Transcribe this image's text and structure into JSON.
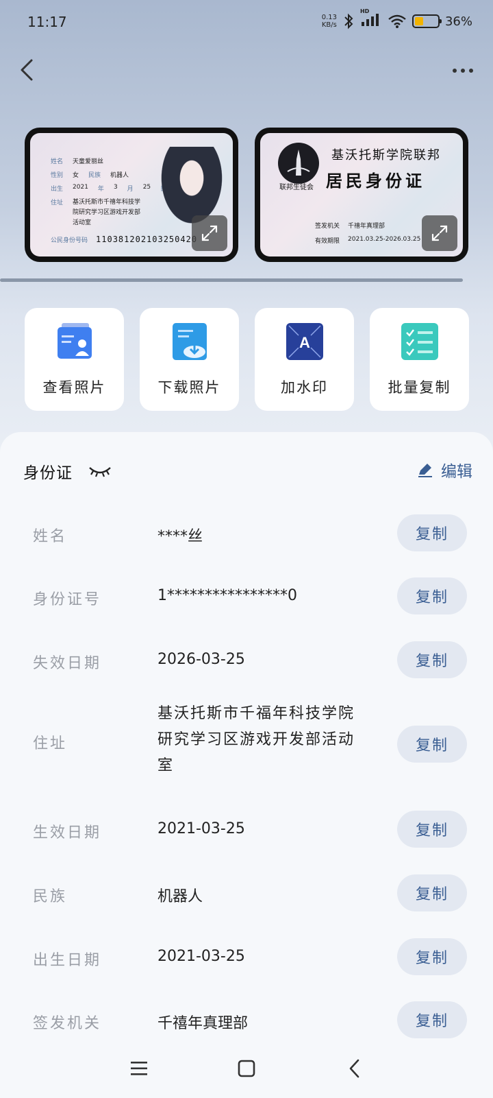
{
  "status": {
    "time": "11:17",
    "net_speed_value": "0.13",
    "net_speed_unit": "KB/s",
    "hd_label": "HD",
    "battery_level": 0.36,
    "battery_pct": "36%",
    "battery_fill_color": "#f2b300"
  },
  "cards": {
    "front": {
      "name_label": "姓名",
      "name": "天童爱丽丝",
      "sex_label": "性别",
      "sex": "女",
      "ethnicity_label": "民族",
      "ethnicity": "机器人",
      "birth_label": "出生",
      "birth_year": "2021",
      "birth_year_unit": "年",
      "birth_month": "3",
      "birth_month_unit": "月",
      "birth_day": "25",
      "birth_day_unit": "日",
      "address_label": "住址",
      "address_line1": "基沃托斯市千禧年科技学",
      "address_line2": "院研究学习区游戏开发部",
      "address_line3": "活动室",
      "id_label": "公民身份号码",
      "id_number": "110381202103250420"
    },
    "back": {
      "title1": "基沃托斯学院联邦",
      "title2": "居民身份证",
      "union_name": "联邦生徒会",
      "authority_label": "签发机关",
      "authority": "千禧年真理部",
      "validity_label": "有效期限",
      "validity": "2021.03.25-2026.03.25"
    }
  },
  "actions": [
    {
      "label": "查看照片",
      "icon": "view-photo-icon"
    },
    {
      "label": "下载照片",
      "icon": "download-photo-icon"
    },
    {
      "label": "加水印",
      "icon": "watermark-icon"
    },
    {
      "label": "批量复制",
      "icon": "batch-copy-icon"
    }
  ],
  "sheet": {
    "title": "身份证",
    "edit_label": "编辑",
    "copy_label": "复制",
    "rows": [
      {
        "key": "姓名",
        "value": "****丝"
      },
      {
        "key": "身份证号",
        "value": "1****************0"
      },
      {
        "key": "失效日期",
        "value": "2026-03-25"
      },
      {
        "key": "住址",
        "value_lines": [
          "基沃托斯市千福年科技学院",
          "研究学习区游戏开发部活动",
          "室"
        ]
      },
      {
        "key": "生效日期",
        "value": "2021-03-25"
      },
      {
        "key": "民族",
        "value": "机器人"
      },
      {
        "key": "出生日期",
        "value": "2021-03-25"
      },
      {
        "key": "签发机关",
        "value": "千禧年真理部"
      }
    ]
  },
  "colors": {
    "accent": "#3a5e93",
    "copy_button_bg": "#e3e8f1"
  }
}
